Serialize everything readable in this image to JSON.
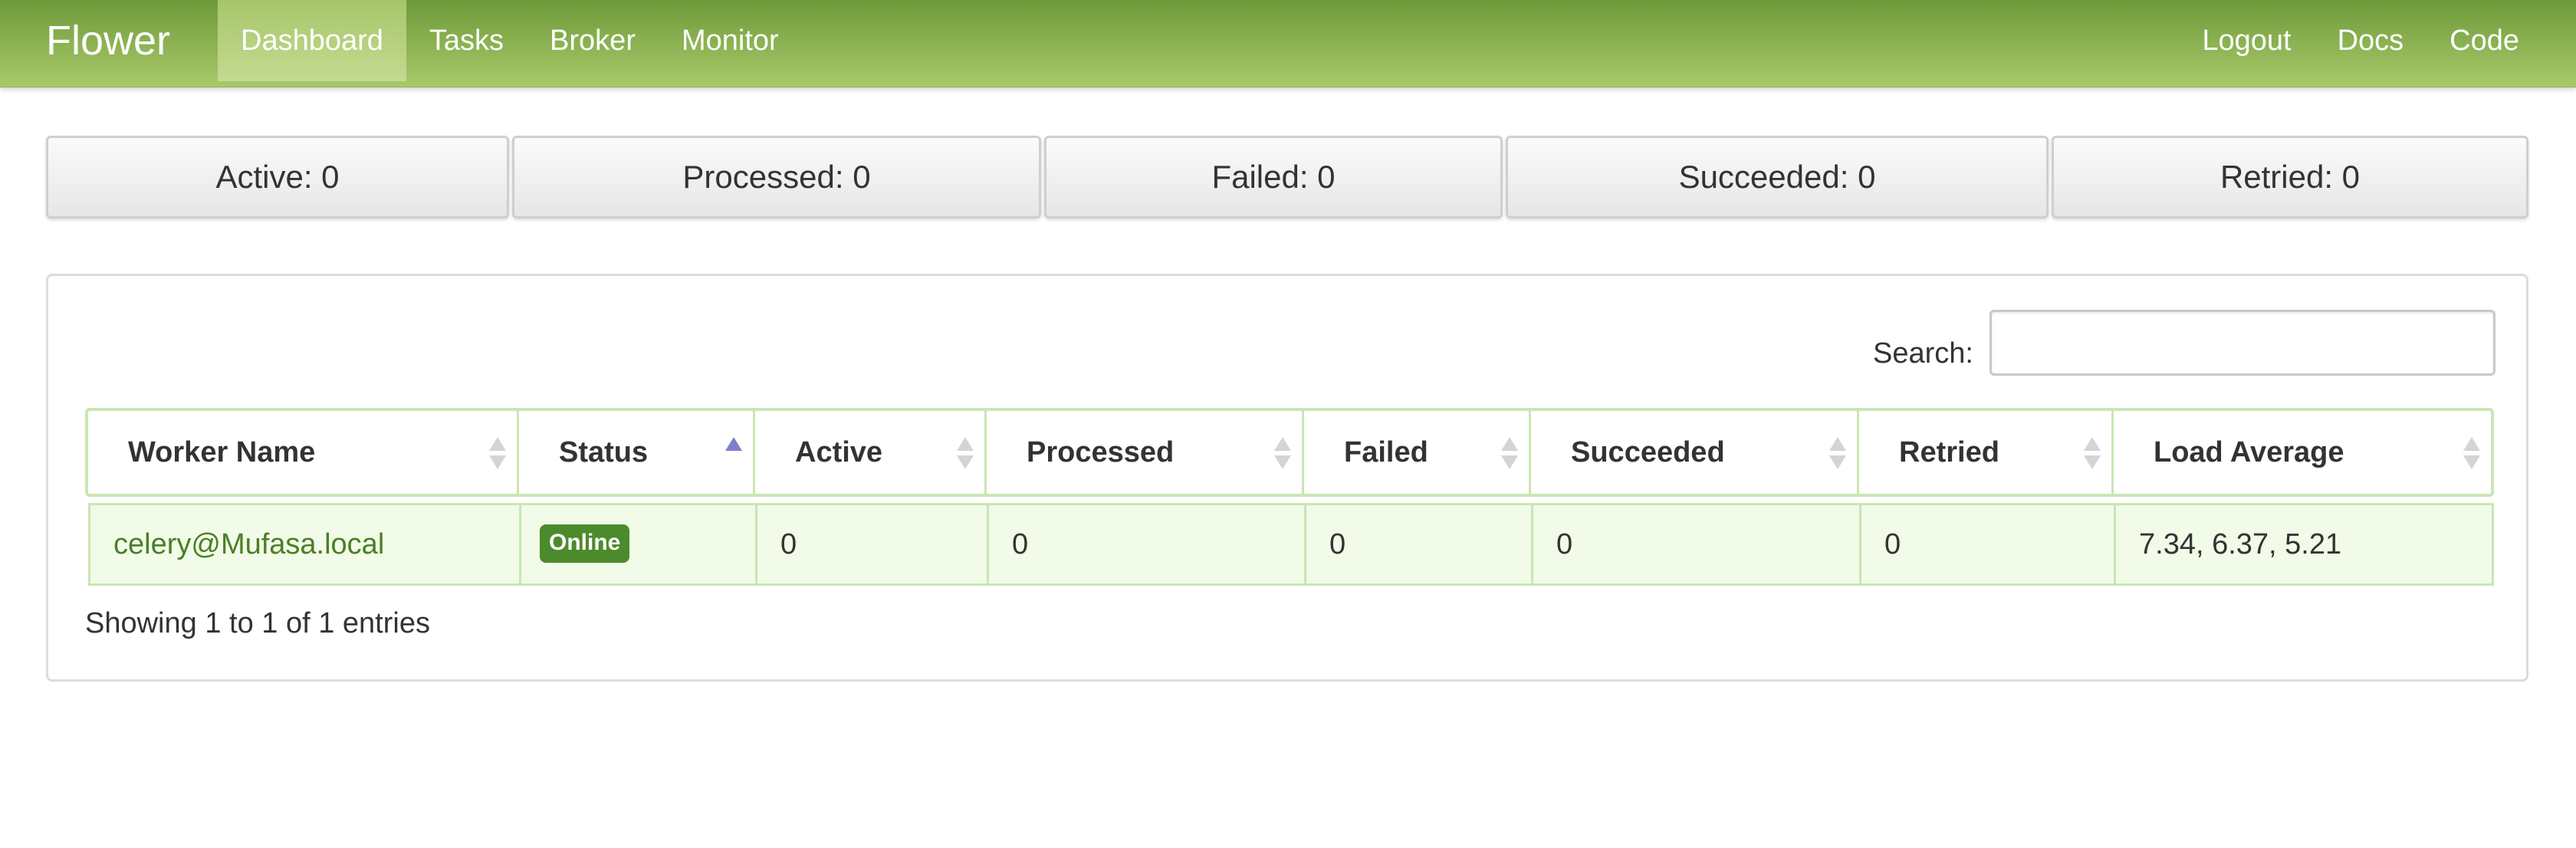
{
  "navbar": {
    "brand": "Flower",
    "left_items": [
      {
        "label": "Dashboard",
        "active": true
      },
      {
        "label": "Tasks",
        "active": false
      },
      {
        "label": "Broker",
        "active": false
      },
      {
        "label": "Monitor",
        "active": false
      }
    ],
    "right_items": [
      {
        "label": "Logout"
      },
      {
        "label": "Docs"
      },
      {
        "label": "Code"
      }
    ]
  },
  "summary": [
    {
      "label": "Active: 0"
    },
    {
      "label": "Processed: 0"
    },
    {
      "label": "Failed: 0"
    },
    {
      "label": "Succeeded: 0"
    },
    {
      "label": "Retried: 0"
    }
  ],
  "search": {
    "label": "Search:",
    "value": "",
    "placeholder": ""
  },
  "table": {
    "columns": [
      "Worker Name",
      "Status",
      "Active",
      "Processed",
      "Failed",
      "Succeeded",
      "Retried",
      "Load Average"
    ],
    "sorted_column": "Status",
    "rows": [
      {
        "worker_name": "celery@Mufasa.local",
        "status": "Online",
        "active": "0",
        "processed": "0",
        "failed": "0",
        "succeeded": "0",
        "retried": "0",
        "load_average": "7.34, 6.37, 5.21"
      }
    ],
    "info": "Showing 1 to 1 of 1 entries"
  },
  "colors": {
    "navbar_top": "#6e9a3a",
    "navbar_bottom": "#a9c96a",
    "row_background": "#f1fbe8",
    "badge": "#4c8b2b",
    "link": "#4a7f26",
    "sort_active": "#7f7fcc"
  },
  "icons": {
    "sort": "sort-arrows-icon",
    "sort_asc": "sort-asc-icon"
  }
}
